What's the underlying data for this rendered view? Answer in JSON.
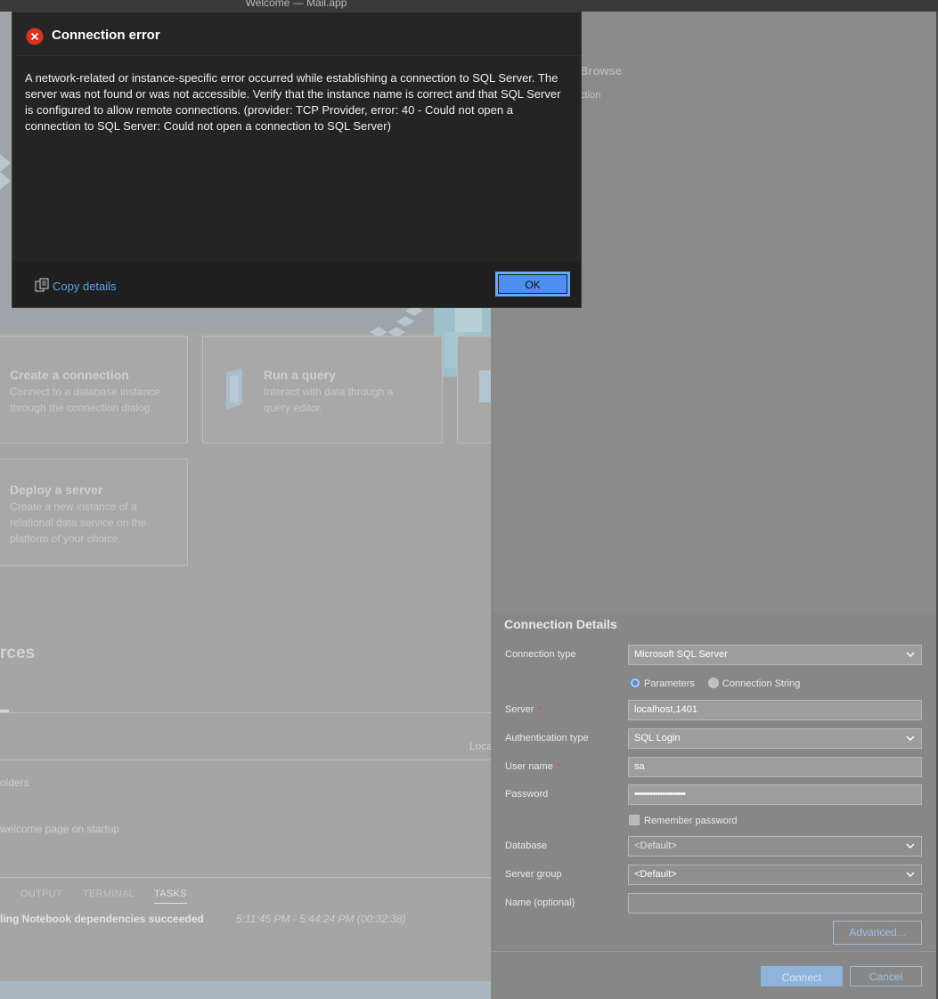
{
  "window": {
    "title": "Welcome — Mail.app"
  },
  "background": {
    "cards": [
      {
        "title": "Create a connection",
        "description": "Connect to a database instance through the connection dialog."
      },
      {
        "title": "Run a query",
        "description": "Interact with data through a query editor."
      },
      {
        "title": "Deploy a server",
        "description": "Create a new instance of a relational data service on the platform of your choice."
      }
    ],
    "resources_heading_fragment": "rces",
    "loca_fragment": "Loca",
    "folders_fragment": "olders",
    "startup_fragment": "welcome page on startup",
    "tabs": [
      "OUTPUT",
      "TERMINAL",
      "TASKS"
    ],
    "active_tab": "TASKS",
    "task": {
      "text": "ling Notebook dependencies succeeded",
      "time": "5:11:45 PM - 5:44:24 PM (00:32:38)"
    }
  },
  "connection": {
    "browse_title": "Browse",
    "browse_sub": "ction",
    "title": "Connection Details",
    "fields": {
      "connection_type": {
        "label": "Connection type",
        "value": "Microsoft SQL Server"
      },
      "mode_parameters": "Parameters",
      "mode_connection_string": "Connection String",
      "server": {
        "label": "Server",
        "required_mark": "*",
        "value": "localhost,1401"
      },
      "auth_type": {
        "label": "Authentication type",
        "value": "SQL Login"
      },
      "user_name": {
        "label": "User name",
        "required_mark": "*",
        "value": "sa"
      },
      "password": {
        "label": "Password",
        "value": "••••••••••••••••••••"
      },
      "remember_password": "Remember password",
      "database": {
        "label": "Database",
        "placeholder": "<Default>"
      },
      "server_group": {
        "label": "Server group",
        "value": "<Default>"
      },
      "name_optional": {
        "label": "Name (optional)",
        "value": ""
      }
    },
    "advanced_button": "Advanced...",
    "connect_button": "Connect",
    "cancel_button": "Cancel"
  },
  "error_dialog": {
    "title": "Connection error",
    "message": "A network-related or instance-specific error occurred while establishing a connection to SQL Server. The server was not found or was not accessible. Verify that the instance name is correct and that SQL Server is configured to allow remote connections. (provider: TCP Provider, error: 40 - Could not open a connection to SQL Server: Could not open a connection to SQL Server)",
    "copy_details": "Copy details",
    "ok": "OK"
  },
  "colors": {
    "error_red": "#d8341f",
    "accent_blue": "#4c8ff0",
    "link_blue": "#5aa3f0"
  }
}
